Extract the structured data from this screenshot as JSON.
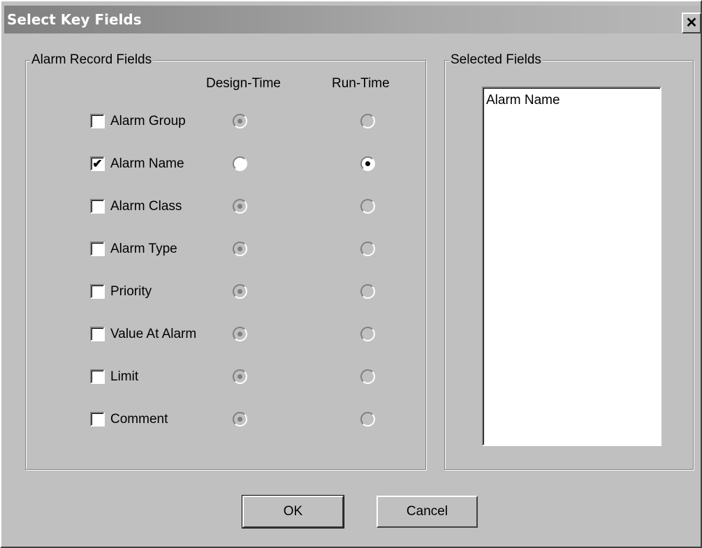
{
  "window": {
    "title": "Select Key Fields",
    "close_glyph": "✕"
  },
  "alarm_group": {
    "legend": "Alarm Record Fields",
    "col_design": "Design-Time",
    "col_run": "Run-Time",
    "rows": [
      {
        "label": "Alarm Group",
        "checked": false,
        "design_selected": true,
        "run_selected": false,
        "enabled": false
      },
      {
        "label": "Alarm Name",
        "checked": true,
        "design_selected": false,
        "run_selected": true,
        "enabled": true
      },
      {
        "label": "Alarm Class",
        "checked": false,
        "design_selected": true,
        "run_selected": false,
        "enabled": false
      },
      {
        "label": "Alarm Type",
        "checked": false,
        "design_selected": true,
        "run_selected": false,
        "enabled": false
      },
      {
        "label": "Priority",
        "checked": false,
        "design_selected": true,
        "run_selected": false,
        "enabled": false
      },
      {
        "label": "Value At Alarm",
        "checked": false,
        "design_selected": true,
        "run_selected": false,
        "enabled": false
      },
      {
        "label": "Limit",
        "checked": false,
        "design_selected": true,
        "run_selected": false,
        "enabled": false
      },
      {
        "label": "Comment",
        "checked": false,
        "design_selected": true,
        "run_selected": false,
        "enabled": false
      }
    ]
  },
  "selected_group": {
    "legend": "Selected Fields",
    "items": [
      "Alarm Name"
    ]
  },
  "buttons": {
    "ok": "OK",
    "cancel": "Cancel"
  },
  "colors": {
    "face": "#c0c0c0",
    "title_bar": "#808080",
    "title_text": "#ffffff"
  }
}
